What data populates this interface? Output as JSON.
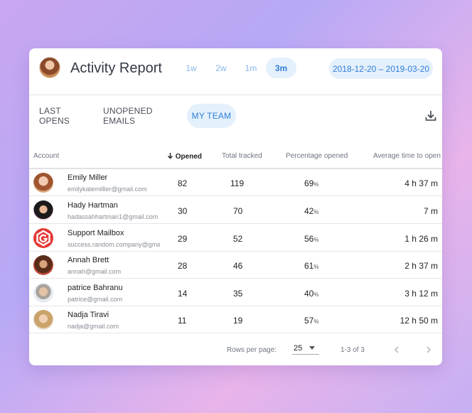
{
  "header": {
    "title": "Activity Report",
    "ranges": [
      {
        "label": "1w",
        "active": false
      },
      {
        "label": "2w",
        "active": false
      },
      {
        "label": "1m",
        "active": false
      },
      {
        "label": "3m",
        "active": true
      }
    ],
    "date_range": "2018-12-20 – 2019-03-20"
  },
  "tabs": [
    {
      "label": "LAST OPENS",
      "active": false
    },
    {
      "label": "UNOPENED EMAILS",
      "active": false
    },
    {
      "label": "MY TEAM",
      "active": true
    }
  ],
  "table": {
    "columns": {
      "account": "Account",
      "opened": "Opened",
      "total": "Total tracked",
      "percentage": "Percentage opened",
      "avg_time": "Average time to open"
    },
    "rows": [
      {
        "name": "Emily Miller",
        "email": "emilykatemilller@gmail.com",
        "opened": "82",
        "total": "119",
        "pct": "69",
        "pct_unit": "%",
        "avg": "4 h 37 m"
      },
      {
        "name": "Hady Hartman",
        "email": "hadassahhartman1@gmail.com",
        "opened": "30",
        "total": "70",
        "pct": "42",
        "pct_unit": "%",
        "avg": "7 m"
      },
      {
        "name": "Support Mailbox",
        "email": "success.random.company@gma",
        "opened": "29",
        "total": "52",
        "pct": "56",
        "pct_unit": "%",
        "avg": "1 h 26 m"
      },
      {
        "name": "Annah Brett",
        "email": "annah@gmail.com",
        "opened": "28",
        "total": "46",
        "pct": "61",
        "pct_unit": "%",
        "avg": "2 h 37 m"
      },
      {
        "name": "patrice Bahranu",
        "email": "patrice@gmail.com",
        "opened": "14",
        "total": "35",
        "pct": "40",
        "pct_unit": "%",
        "avg": "3 h 12 m"
      },
      {
        "name": "Nadja Tiravi",
        "email": "nadja@gmail.com",
        "opened": "11",
        "total": "19",
        "pct": "57",
        "pct_unit": "%",
        "avg": "12 h 50 m"
      }
    ]
  },
  "footer": {
    "rows_per_page_label": "Rows per page:",
    "rows_per_page_value": "25",
    "range_text": "1-3 of 3"
  },
  "icons": {
    "download": "download-icon",
    "sort": "arrow-down-icon",
    "prev": "chevron-left-icon",
    "next": "chevron-right-icon"
  },
  "colors": {
    "accent": "#2f7fd8",
    "accent_bg": "#e4f0fc",
    "support_logo": "#e53935"
  }
}
